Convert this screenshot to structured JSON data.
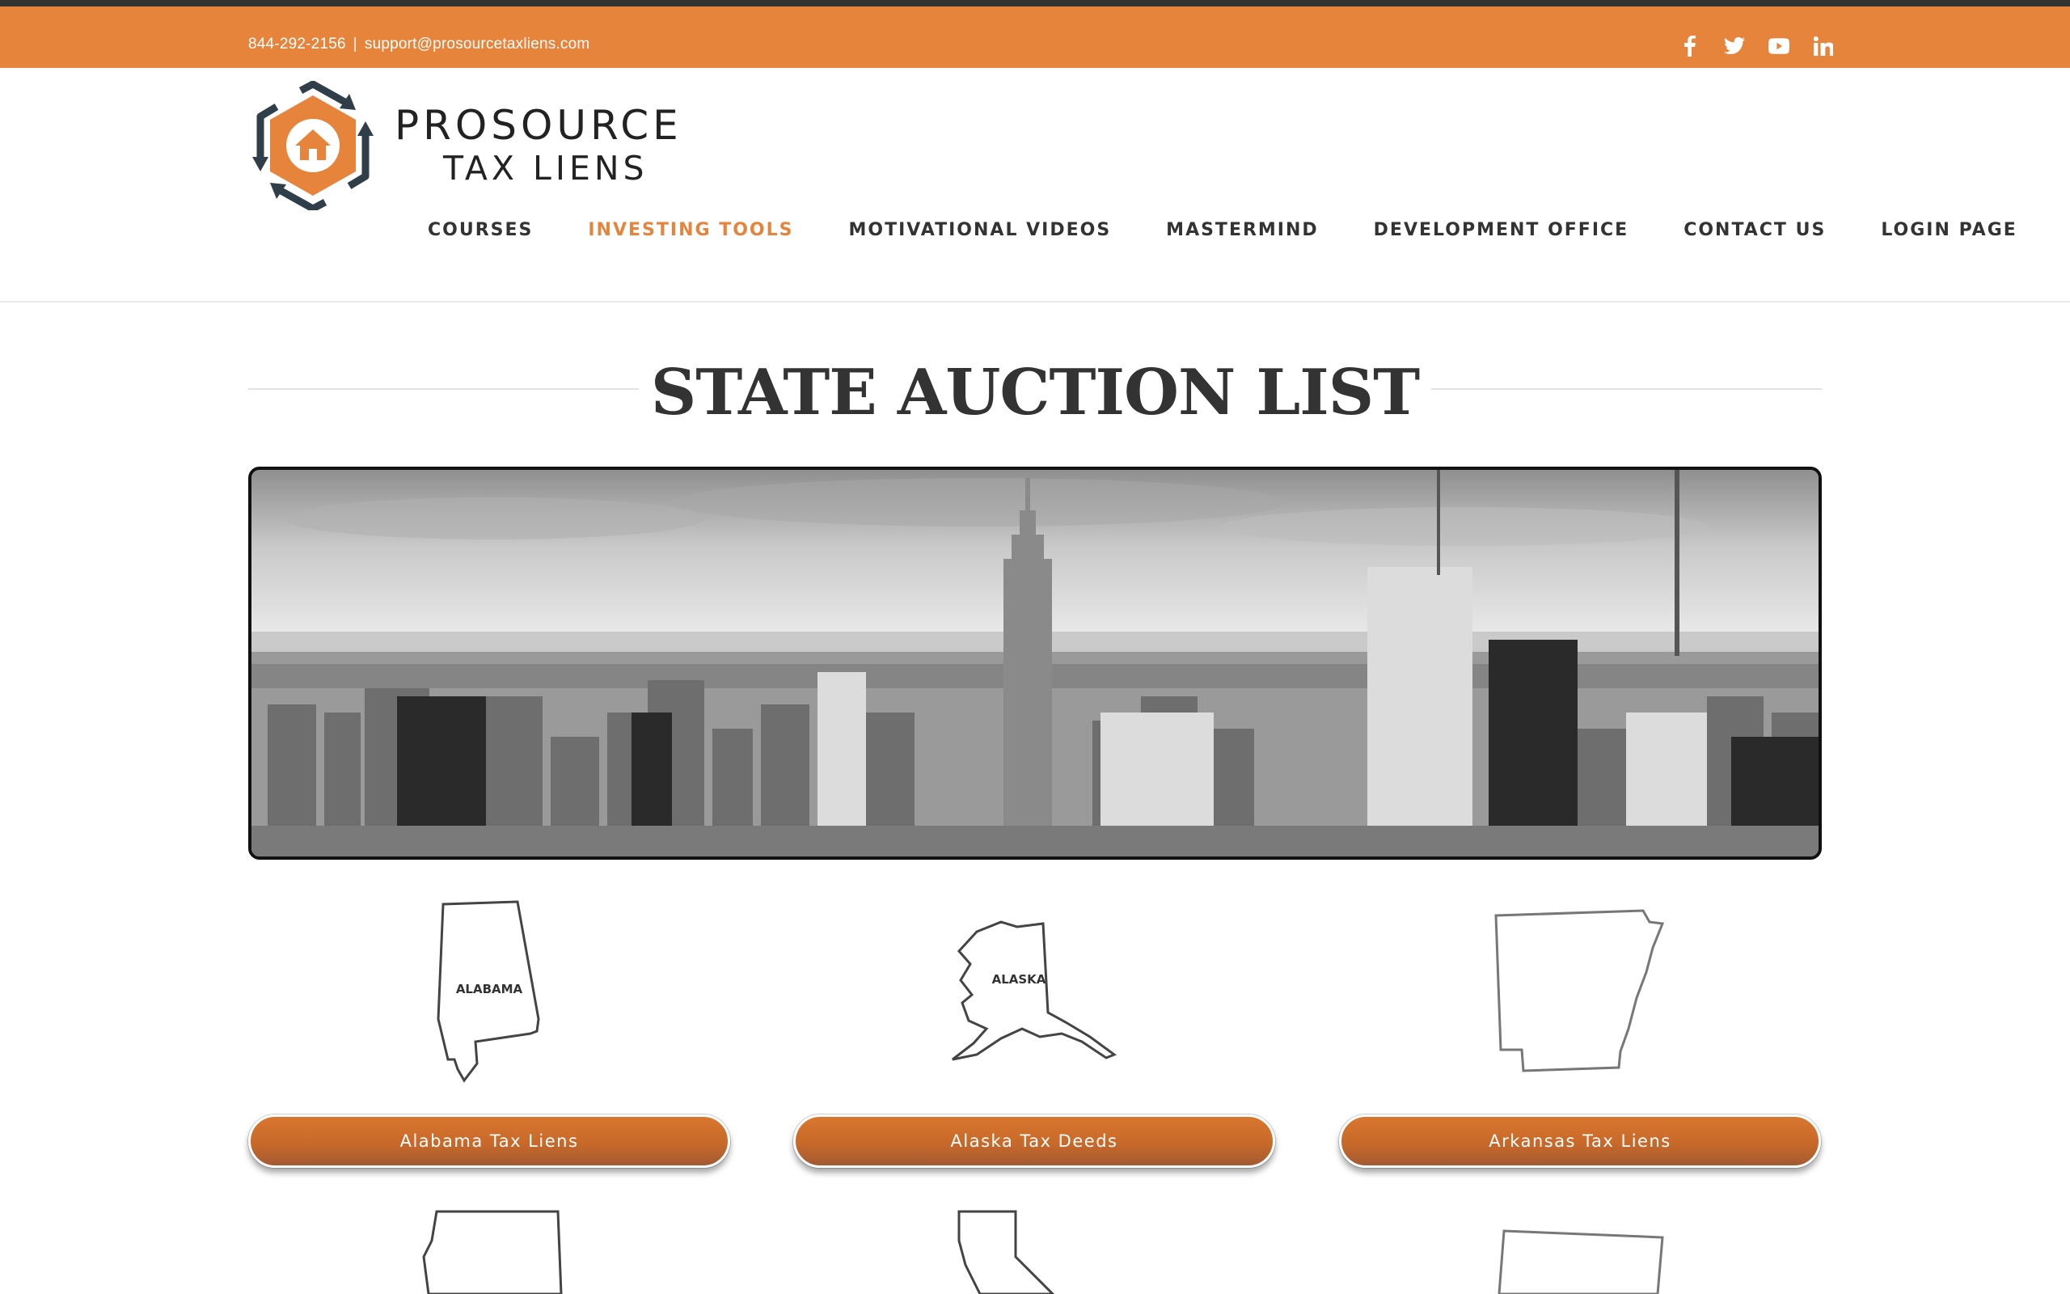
{
  "topbar": {
    "phone": "844-292-2156",
    "separator": "|",
    "email": "support@prosourcetaxliens.com",
    "social": [
      "facebook-icon",
      "twitter-icon",
      "youtube-icon",
      "linkedin-icon"
    ],
    "bg_color": "#e6843c"
  },
  "logo": {
    "line1": "PROSOURCE",
    "line2": "TAX LIENS"
  },
  "nav": {
    "items": [
      {
        "label": "COURSES"
      },
      {
        "label": "INVESTING TOOLS"
      },
      {
        "label": "MOTIVATIONAL VIDEOS"
      },
      {
        "label": "MASTERMIND"
      },
      {
        "label": "DEVELOPMENT OFFICE"
      },
      {
        "label": "CONTACT US"
      },
      {
        "label": "LOGIN PAGE"
      }
    ],
    "active_color": "#e6843c"
  },
  "page": {
    "title": "STATE AUCTION LIST"
  },
  "states": [
    {
      "map_label": "ALABAMA",
      "button": "Alabama Tax Liens"
    },
    {
      "map_label": "ALASKA",
      "button": "Alaska Tax Deeds"
    },
    {
      "map_label": "",
      "button": "Arkansas Tax Liens"
    }
  ],
  "colors": {
    "accent": "#e6843c",
    "button": "#c8692a",
    "text_dark": "#333333"
  }
}
